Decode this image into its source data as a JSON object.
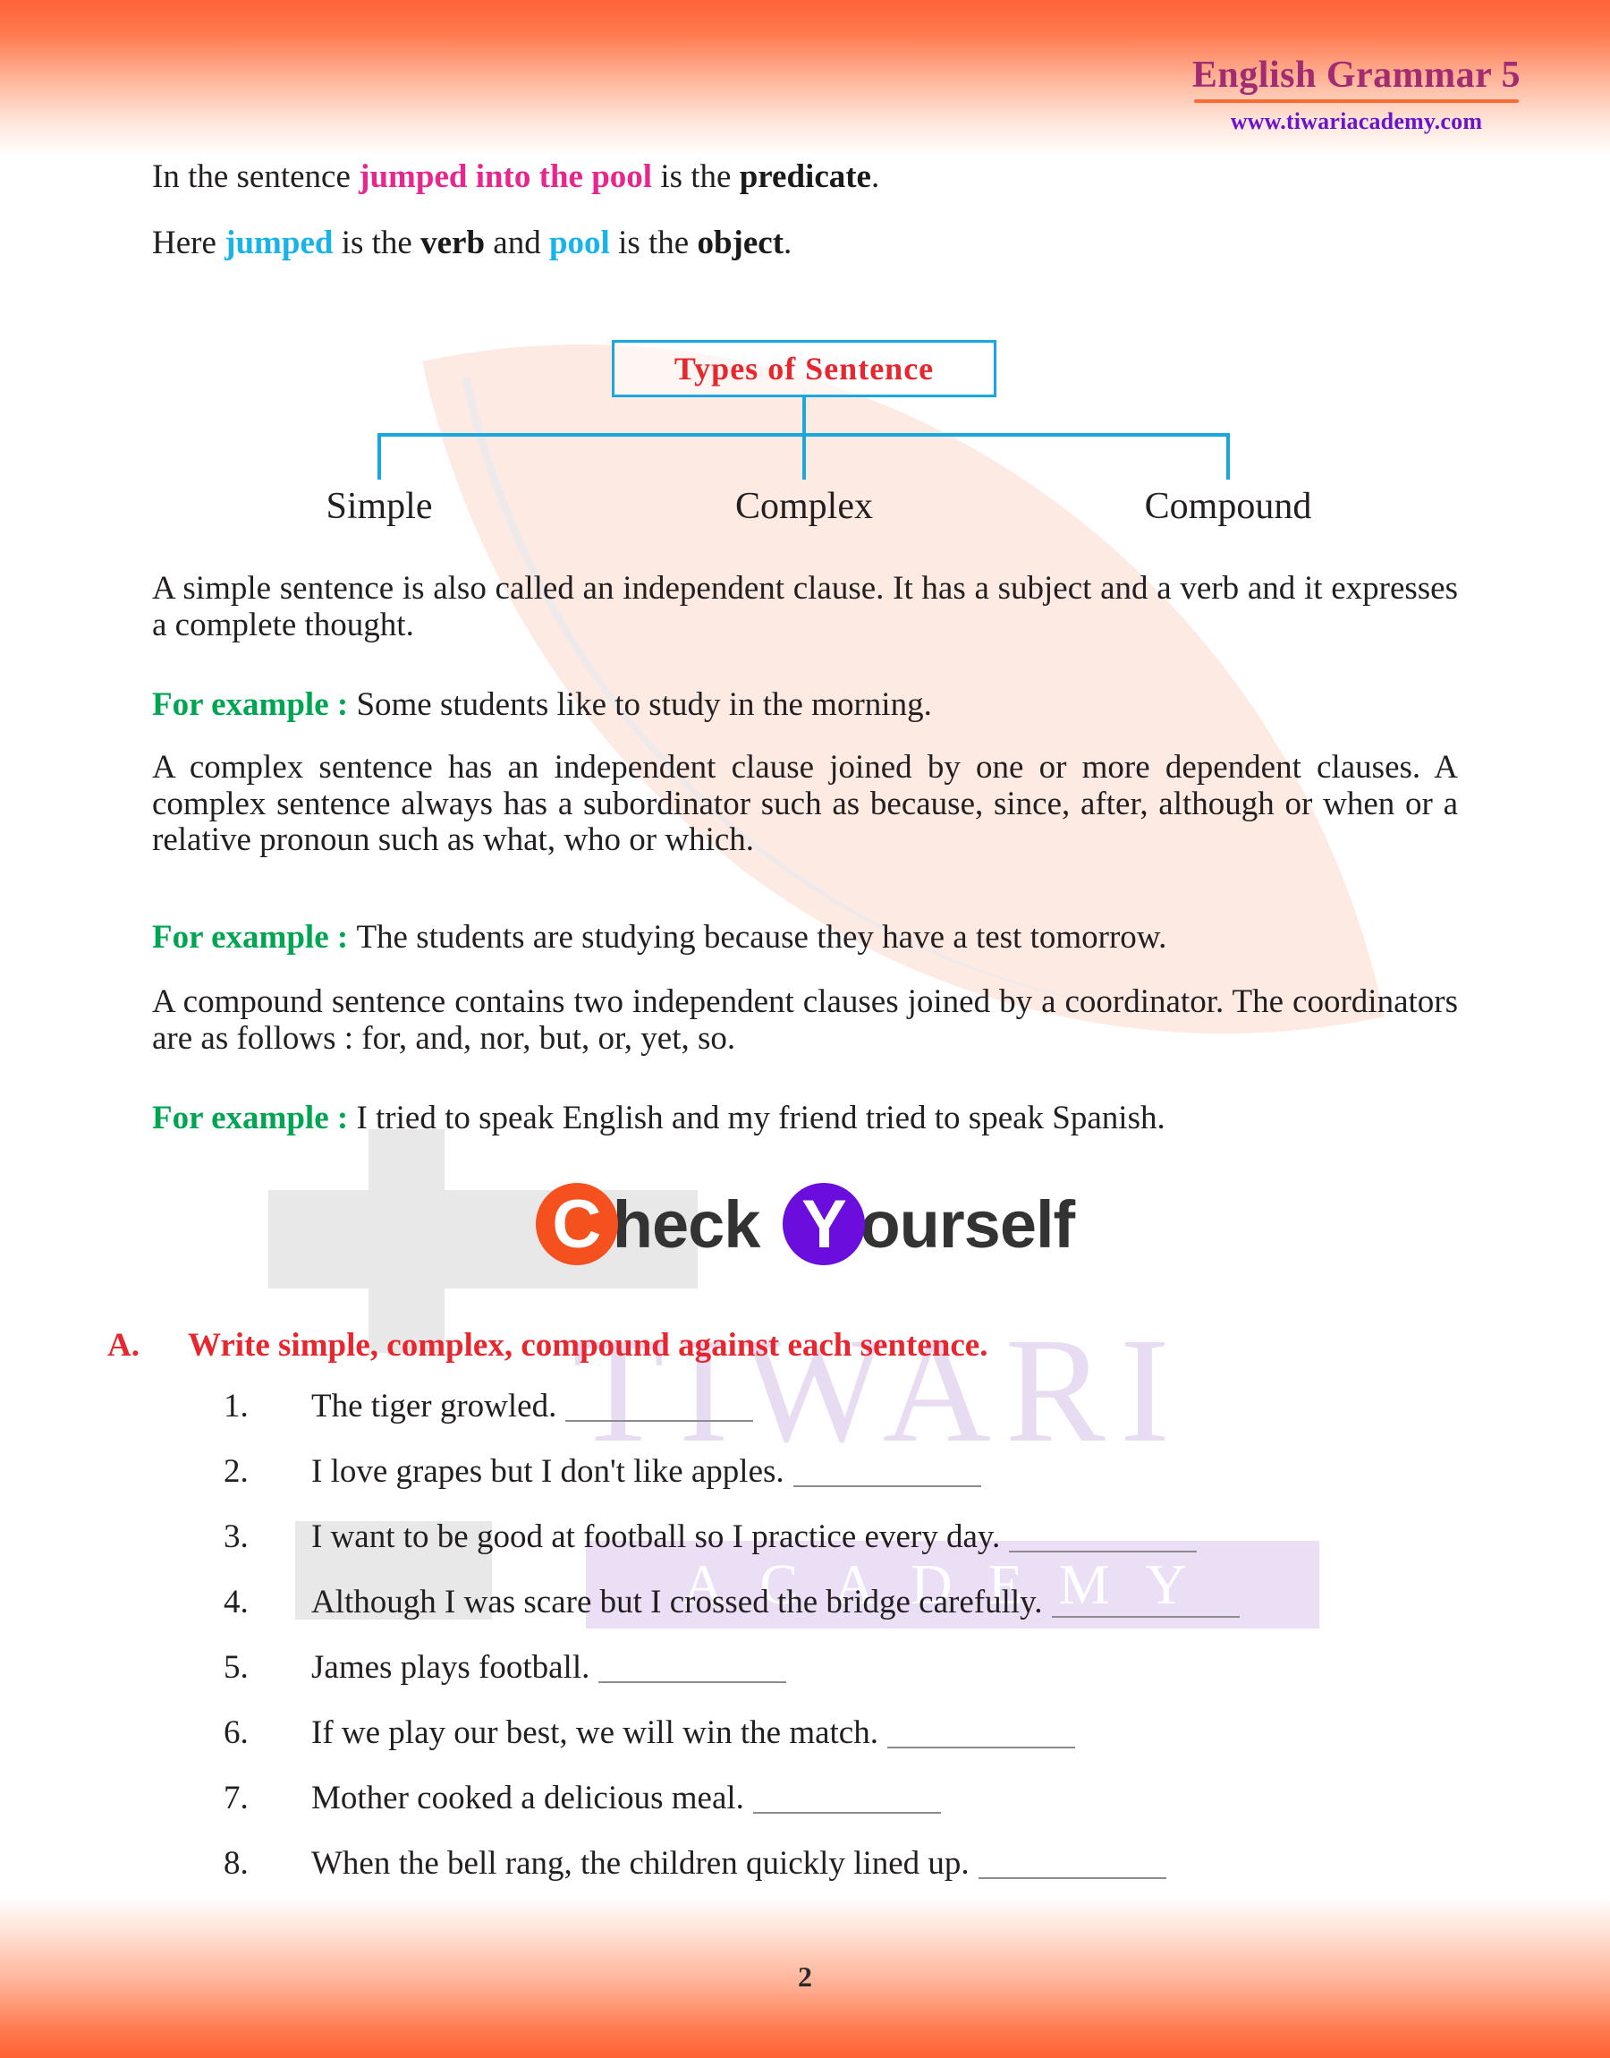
{
  "header": {
    "title": "English Grammar 5",
    "url": "www.tiwariacademy.com",
    "title_color": "#a32b72",
    "url_color": "#6c14c9",
    "rule_color": "#ff6a33"
  },
  "intro": {
    "line1": {
      "pre": "In the sentence ",
      "highlight": "jumped into the pool",
      "mid": " is the ",
      "bold": "predicate",
      "post": "."
    },
    "line2": {
      "pre": "Here ",
      "h1": "jumped",
      "m1": " is the ",
      "b1": "verb",
      "m2": " and ",
      "h2": "pool",
      "m3": " is the ",
      "b2": "object",
      "post": "."
    }
  },
  "diagram": {
    "root_label": "Types  of  Sentence",
    "root_border_color": "#18a7e0",
    "root_text_color": "#e8262e",
    "branches": [
      "Simple",
      "Complex",
      "Compound"
    ]
  },
  "sections": [
    {
      "body": "A simple sentence is also called an independent clause. It has a subject and a verb and it expresses a complete thought."
    },
    {
      "example_label": "For example : ",
      "example_text": "Some students like to study in the morning."
    },
    {
      "body": "A complex sentence has an independent clause joined by one or more dependent clauses. A complex sentence always has a subordinator such as because, since, after, although or when or a relative pronoun such as what, who or which."
    },
    {
      "example_label": "For example : ",
      "example_text": "The students are studying because they have a test tomorrow."
    },
    {
      "body": "A compound sentence contains two independent clauses joined by a coordinator. The coordinators are as follows : for, and, nor, but, or, yet, so."
    },
    {
      "example_label": "For example : ",
      "example_text": "I tried to speak English and my friend tried to speak Spanish."
    }
  ],
  "check_yourself": {
    "cap_c": "C",
    "word_check": "heck",
    "cap_y": "Y",
    "word_yourself": "ourself",
    "c_disc_color": "#f4511e",
    "y_disc_color": "#6a0ddd"
  },
  "exercise": {
    "marker": "A.",
    "instruction": "Write simple, complex, compound against each sentence.",
    "instruction_color": "#e8262e",
    "questions": [
      {
        "num": "1.",
        "text": "The tiger growled.",
        "blank_width": 210
      },
      {
        "num": "2.",
        "text": "I love grapes but I don't like apples.",
        "blank_width": 210
      },
      {
        "num": "3.",
        "text": "I want to be good at football so I practice every day.",
        "blank_width": 210
      },
      {
        "num": "4.",
        "text": "Although I was scare but I crossed the bridge carefully.",
        "blank_width": 210
      },
      {
        "num": "5.",
        "text": "James plays football.",
        "blank_width": 210
      },
      {
        "num": "6.",
        "text": "If we play our best, we will win the match.",
        "blank_width": 210
      },
      {
        "num": "7.",
        "text": "Mother cooked a delicious meal.",
        "blank_width": 210
      },
      {
        "num": "8.",
        "text": "When the bell rang, the children quickly lined up.",
        "blank_width": 210
      }
    ]
  },
  "watermarks": {
    "brand_text": "TIWARI",
    "brand_sub": "ACADEMY"
  },
  "footer": {
    "page_number": "2"
  }
}
